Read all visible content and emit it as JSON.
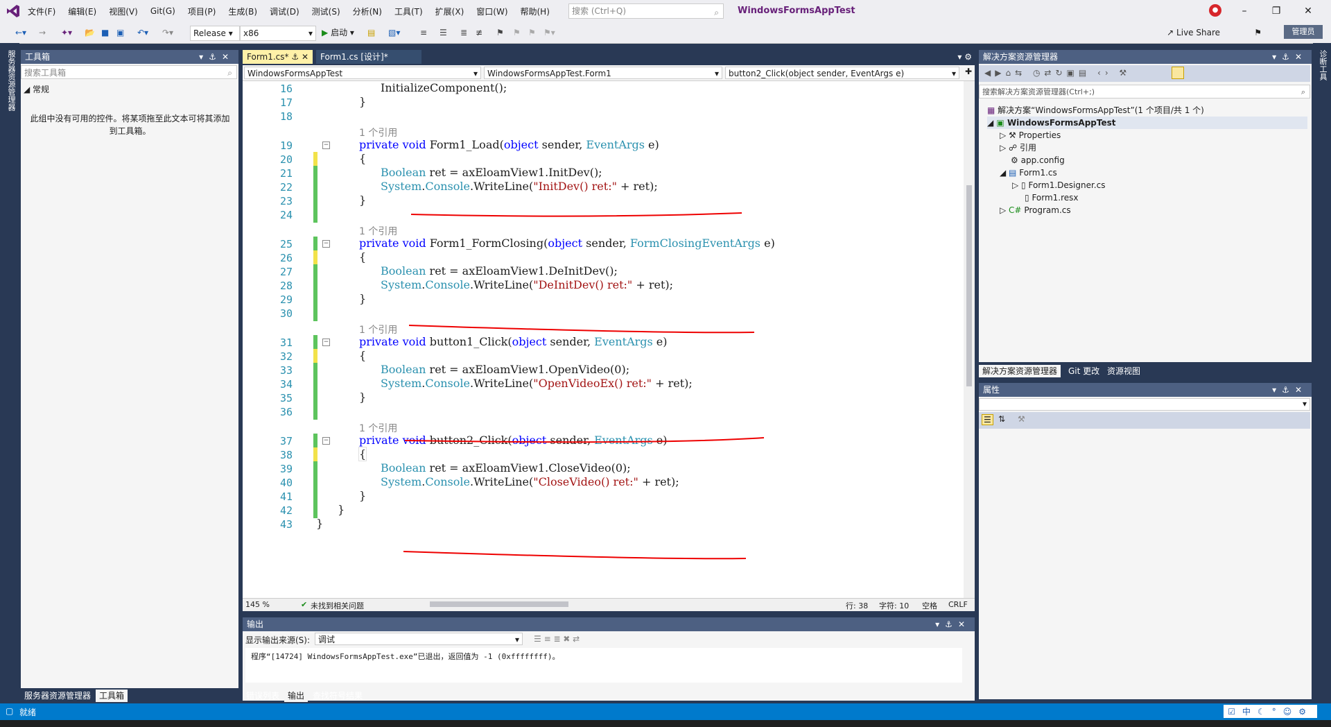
{
  "menu": [
    "文件(F)",
    "编辑(E)",
    "视图(V)",
    "Git(G)",
    "项目(P)",
    "生成(B)",
    "调试(D)",
    "测试(S)",
    "分析(N)",
    "工具(T)",
    "扩展(X)",
    "窗口(W)",
    "帮助(H)"
  ],
  "search_placeholder": "搜索 (Ctrl+Q)",
  "solution_title": "WindowsFormsAppTest",
  "toolbar": {
    "config": "Release",
    "platform": "x86",
    "start": "启动",
    "live_share": "Live Share",
    "admin": "管理员"
  },
  "toolbox": {
    "title": "工具箱",
    "search_placeholder": "搜索工具箱",
    "group": "常规",
    "empty_msg": "此组中没有可用的控件。将某项拖至此文本可将其添加到工具箱。"
  },
  "left_tabs": {
    "rail": "服务器资源管理器",
    "server_explorer": "服务器资源管理器",
    "toolbox": "工具箱"
  },
  "doc_tabs": [
    "Form1.cs*",
    "Form1.cs [设计]*"
  ],
  "nav": {
    "project": "WindowsFormsAppTest",
    "class": "WindowsFormsAppTest.Form1",
    "member": "button2_Click(object sender, EventArgs e)"
  },
  "code_lines": [
    {
      "n": "16",
      "t": "InitializeComponent();"
    },
    {
      "n": "17",
      "t": "}"
    },
    {
      "n": "18",
      "t": ""
    },
    {
      "n": "19",
      "t": "private void Form1_Load(object sender, EventArgs e)"
    },
    {
      "n": "20",
      "t": "{"
    },
    {
      "n": "21",
      "t": "Boolean ret = axEloamView1.InitDev();"
    },
    {
      "n": "22",
      "t": "System.Console.WriteLine(\"InitDev() ret:\" + ret);"
    },
    {
      "n": "23",
      "t": "}"
    },
    {
      "n": "24",
      "t": ""
    },
    {
      "n": "25",
      "t": "private void Form1_FormClosing(object sender, FormClosingEventArgs e)"
    },
    {
      "n": "26",
      "t": "{"
    },
    {
      "n": "27",
      "t": "Boolean ret = axEloamView1.DeInitDev();"
    },
    {
      "n": "28",
      "t": "System.Console.WriteLine(\"DeInitDev() ret:\" + ret);"
    },
    {
      "n": "29",
      "t": "}"
    },
    {
      "n": "30",
      "t": ""
    },
    {
      "n": "31",
      "t": "private void button1_Click(object sender, EventArgs e)"
    },
    {
      "n": "32",
      "t": "{"
    },
    {
      "n": "33",
      "t": "Boolean ret = axEloamView1.OpenVideo(0);"
    },
    {
      "n": "34",
      "t": "System.Console.WriteLine(\"OpenVideoEx() ret:\" + ret);"
    },
    {
      "n": "35",
      "t": "}"
    },
    {
      "n": "36",
      "t": ""
    },
    {
      "n": "37",
      "t": "private void button2_Click(object sender, EventArgs e)"
    },
    {
      "n": "38",
      "t": "{"
    },
    {
      "n": "39",
      "t": "Boolean ret = axEloamView1.CloseVideo(0);"
    },
    {
      "n": "40",
      "t": "System.Console.WriteLine(\"CloseVideo() ret:\" + ret);"
    },
    {
      "n": "41",
      "t": "}"
    },
    {
      "n": "42",
      "t": "}"
    },
    {
      "n": "43",
      "t": "}"
    }
  ],
  "ref_label": "1 个引用",
  "editor_status": {
    "zoom": "145 %",
    "issues": "未找到相关问题",
    "line": "行: 38",
    "col": "字符: 10",
    "ws": "空格",
    "eol": "CRLF"
  },
  "output": {
    "title": "输出",
    "source_label": "显示输出来源(S):",
    "source": "调试",
    "text": "程序“[14724] WindowsFormsAppTest.exe”已退出，返回值为 -1 (0xffffffff)。"
  },
  "bottom_tabs": [
    "错误列表",
    "输出",
    "查找符号结果"
  ],
  "solution_explorer": {
    "title": "解决方案资源管理器",
    "search_placeholder": "搜索解决方案资源管理器(Ctrl+;)",
    "root": "解决方案“WindowsFormsAppTest”(1 个项目/共 1 个)",
    "project": "WindowsFormsAppTest",
    "items": [
      "Properties",
      "引用",
      "app.config",
      "Form1.cs",
      "Form1.Designer.cs",
      "Form1.resx",
      "Program.cs"
    ]
  },
  "se_tabs": [
    "解决方案资源管理器",
    "Git 更改",
    "资源视图"
  ],
  "properties_title": "属性",
  "right_rail": "诊断工具",
  "status": "就绪",
  "colors": {
    "accent": "#007acc",
    "keyword": "#0000ff",
    "type": "#2b91af",
    "string": "#a31515",
    "annotation": "#e00000"
  }
}
